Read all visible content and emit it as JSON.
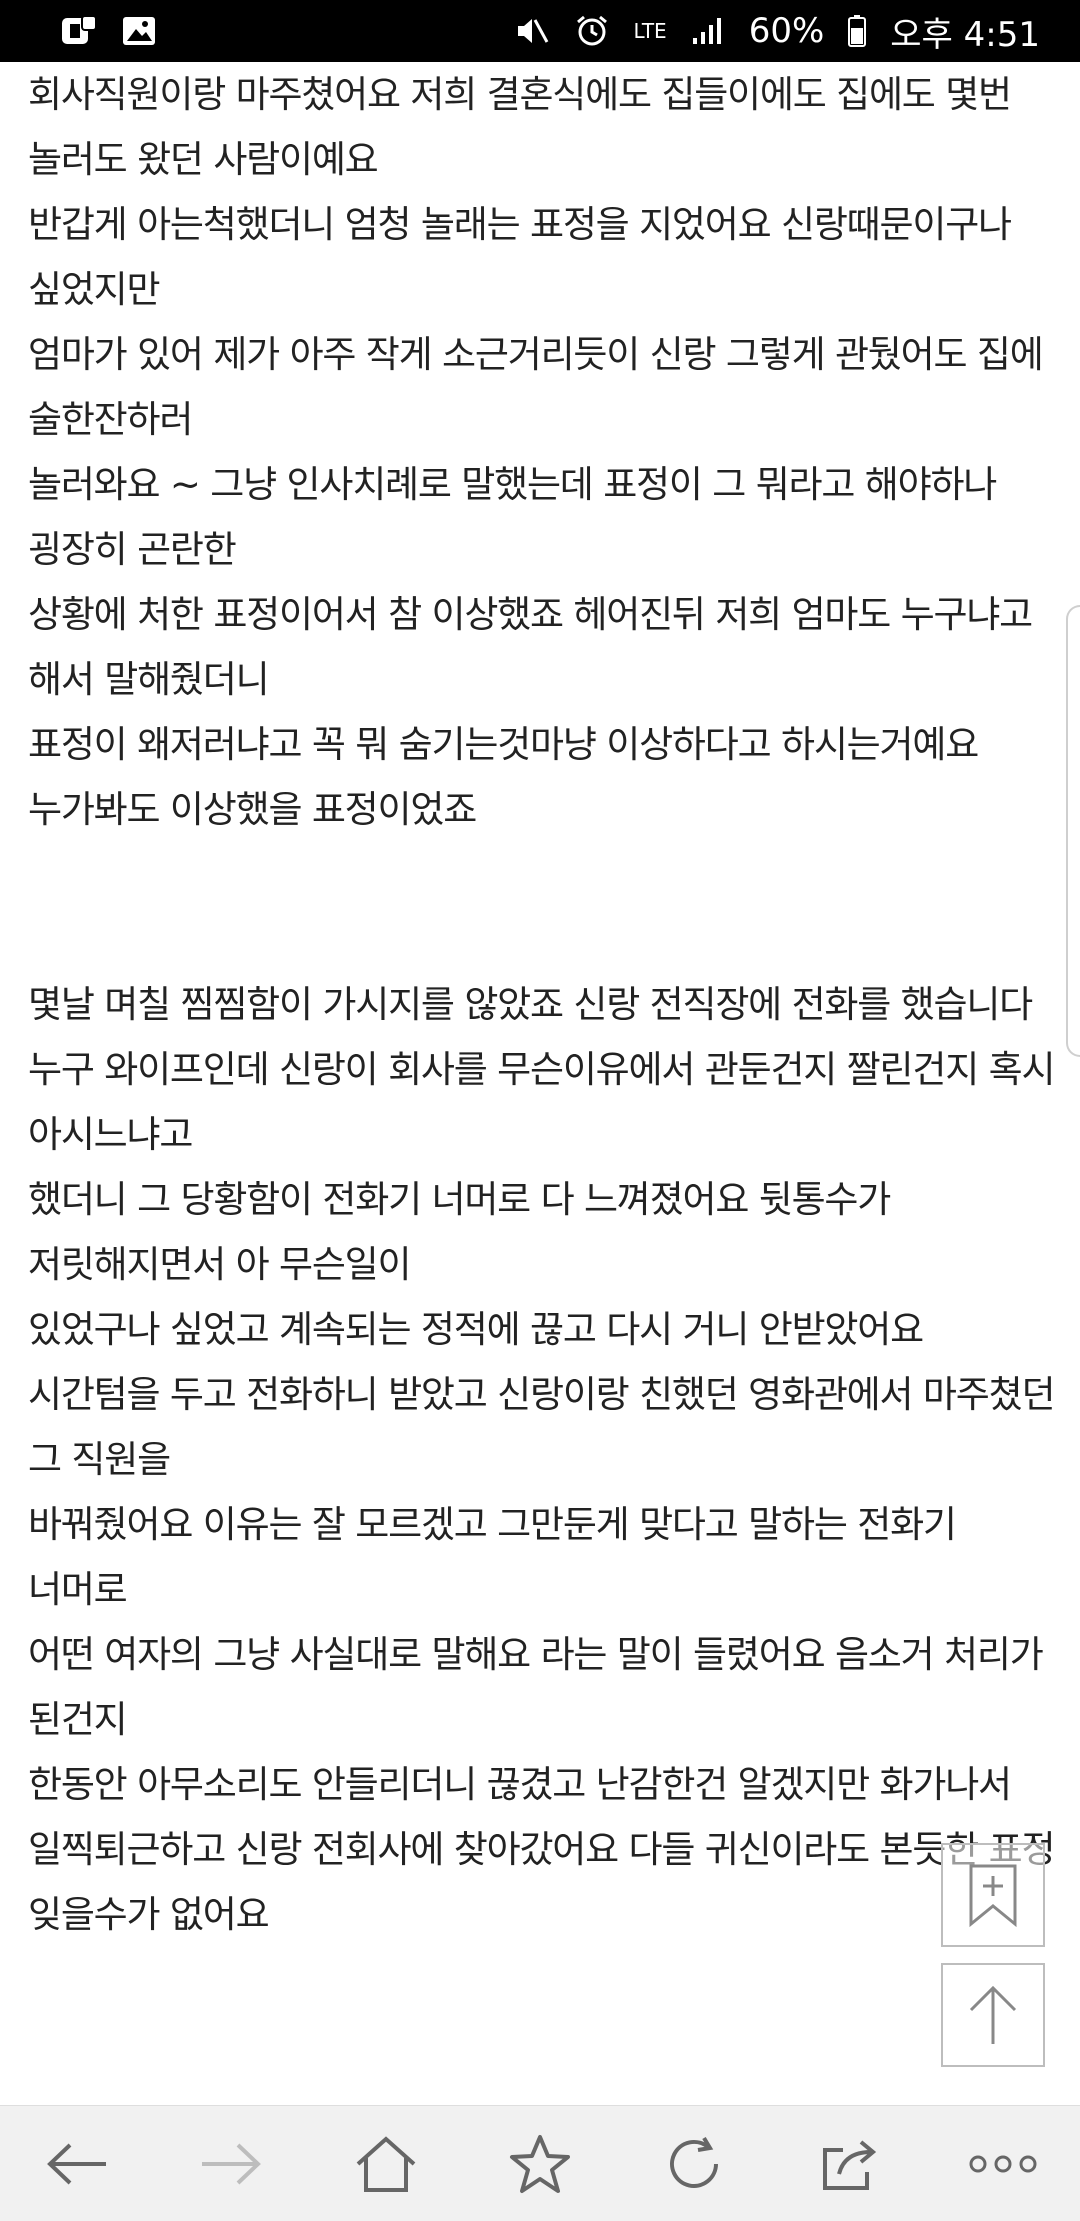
{
  "status_bar": {
    "network": "LTE",
    "battery": "60%",
    "time": "오후 4:51"
  },
  "article": {
    "paragraphs_top": [
      "회사직원이랑 마주쳤어요 저희 결혼식에도 집들이에도 집에도 몇번 놀러도 왔던 사람이예요",
      "반갑게 아는척했더니 엄청 놀래는 표정을 지었어요 신랑때문이구나 싶었지만",
      "엄마가 있어 제가 아주 작게 소근거리듯이 신랑 그렇게 관뒀어도 집에 술한잔하러",
      "놀러와요 ~ 그냥 인사치례로 말했는데 표정이 그 뭐라고 해야하나 굉장히 곤란한",
      "상황에 처한 표정이어서 참 이상했죠 헤어진뒤 저희 엄마도 누구냐고 해서 말해줬더니",
      "표정이 왜저러냐고 꼭 뭐 숨기는것마냥 이상하다고 하시는거예요 누가봐도 이상했을 표정이었죠"
    ],
    "paragraphs_bottom": [
      "몇날 며칠 찜찜함이 가시지를 않았죠 신랑 전직장에 전화를 했습니다",
      "누구 와이프인데 신랑이 회사를 무슨이유에서 관둔건지 짤린건지 혹시 아시느냐고",
      "했더니 그 당황함이 전화기 너머로 다 느껴졌어요 뒷통수가 저릿해지면서 아 무슨일이",
      "있었구나 싶었고 계속되는 정적에 끊고 다시 거니 안받았어요",
      "시간텀을 두고 전화하니 받았고 신랑이랑 친했던 영화관에서 마주쳤던 그 직원을",
      "바꿔줬어요 이유는 잘 모르겠고 그만둔게 맞다고 말하는 전화기 너머로",
      "어떤 여자의 그냥 사실대로 말해요 라는 말이 들렸어요 음소거 처리가 된건지",
      "한동안 아무소리도 안들리더니 끊겼고 난감한건 알겠지만 화가나서",
      "일찍퇴근하고 신랑 전회사에 찾아갔어요 다들 귀신이라도 본듯한 표정 잊을수가 없어요"
    ]
  },
  "floating": {
    "bookmark_add": "bookmark-add-icon",
    "scroll_top": "arrow-up-icon"
  },
  "nav": [
    "back-icon",
    "forward-icon",
    "home-icon",
    "bookmark-star-icon",
    "refresh-icon",
    "share-icon",
    "more-icon"
  ],
  "colors": {
    "status_bg": "#000000",
    "nav_bg": "#f1f1f1",
    "text": "#222222",
    "disabled_icon": "#bdbdbd",
    "icon": "#666666"
  }
}
